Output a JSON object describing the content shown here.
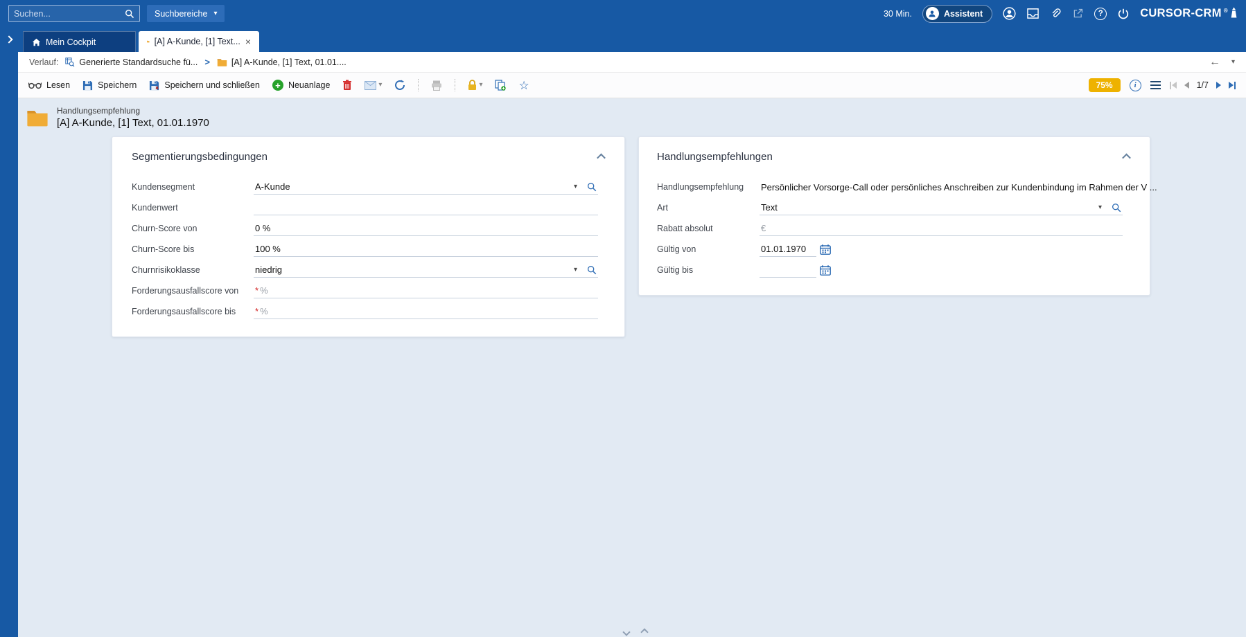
{
  "colors": {
    "topbar_blue": "#1759a4",
    "accent_blue": "#2f6db5",
    "badge_yellow": "#eeb200",
    "folder_yellow": "#f0ac36",
    "required_red": "#d22424"
  },
  "glyphs": {
    "chevron_down": "▾",
    "close": "×",
    "star": "☆",
    "help": "?",
    "info": "i",
    "back_arrow": "←",
    "separator": ">",
    "plus": "+",
    "reg": "®"
  },
  "topbar": {
    "search_placeholder": "Suchen...",
    "scope_button": "Suchbereiche",
    "session_timer": "30 Min.",
    "assistant_label": "Assistent",
    "brand": "CURSOR-CRM"
  },
  "tabbar": {
    "tabs": [
      {
        "label": "Mein Cockpit",
        "active": false
      },
      {
        "label": "[A] A-Kunde, [1] Text...",
        "active": true
      }
    ]
  },
  "breadcrumb": {
    "prefix": "Verlauf:",
    "items": [
      "Generierte Standardsuche fü...",
      "[A] A-Kunde, [1] Text, 01.01...."
    ]
  },
  "toolbar": {
    "read": "Lesen",
    "save": "Speichern",
    "save_and_close": "Speichern und schließen",
    "new": "Neuanlage",
    "quality_badge": "75%",
    "pager": "1/7"
  },
  "record_header": {
    "entity": "Handlungsempfehlung",
    "title": "[A] A-Kunde, [1] Text, 01.01.1970"
  },
  "cards": {
    "segmentation": {
      "title": "Segmentierungsbedingungen",
      "fields": [
        {
          "label": "Kundensegment",
          "value": "A-Kunde",
          "type": "lookup"
        },
        {
          "label": "Kundenwert",
          "value": "",
          "type": "text"
        },
        {
          "label": "Churn-Score von",
          "value": "0 %",
          "type": "text"
        },
        {
          "label": "Churn-Score bis",
          "value": "100 %",
          "type": "text"
        },
        {
          "label": "Churnrisikoklasse",
          "value": "niedrig",
          "type": "lookup"
        },
        {
          "label": "Forderungsausfallscore von",
          "value": "",
          "type": "text",
          "required": true,
          "placeholder": "%"
        },
        {
          "label": "Forderungsausfallscore bis",
          "value": "",
          "type": "text",
          "required": true,
          "placeholder": "%"
        }
      ]
    },
    "recommendation": {
      "title": "Handlungsempfehlungen",
      "fields": [
        {
          "label": "Handlungsempfehlung",
          "value": "Persönlicher Vorsorge-Call oder persönliches Anschreiben zur Kundenbindung im Rahmen der V ...",
          "type": "readonly"
        },
        {
          "label": "Art",
          "value": "Text",
          "type": "lookup"
        },
        {
          "label": "Rabatt absolut",
          "value": "",
          "type": "text",
          "placeholder": "€"
        },
        {
          "label": "Gültig von",
          "value": "01.01.1970",
          "type": "date"
        },
        {
          "label": "Gültig bis",
          "value": "",
          "type": "date"
        }
      ]
    }
  }
}
